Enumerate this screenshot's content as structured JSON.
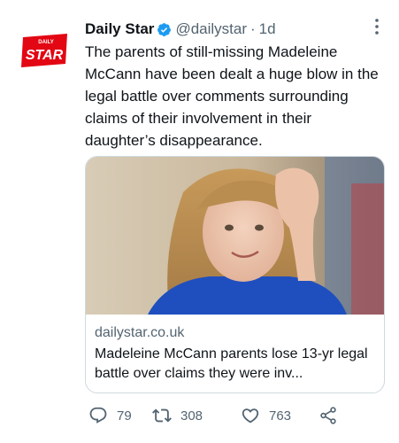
{
  "tweet": {
    "author": {
      "display_name": "Daily Star",
      "handle": "@dailystar",
      "separator": "·",
      "time": "1d",
      "verified": true,
      "avatar_logo_top": "DAILY",
      "avatar_logo_main": "STAR",
      "avatar_color": "#e30613"
    },
    "text": "The parents of still-missing Madeleine McCann have been dealt a huge blow in the legal battle over comments surrounding claims of their involvement in their daughter’s disappearance.",
    "link_card": {
      "image_description_icon": "photo",
      "domain": "dailystar.co.uk",
      "title": "Madeleine McCann parents lose 13-yr legal battle over claims they were inv..."
    },
    "actions": {
      "replies": "79",
      "retweets": "308",
      "likes": "763"
    },
    "colors": {
      "text": "#0f1419",
      "secondary": "#536471",
      "verified_blue": "#1d9bf0",
      "border": "#cfd9de"
    }
  }
}
